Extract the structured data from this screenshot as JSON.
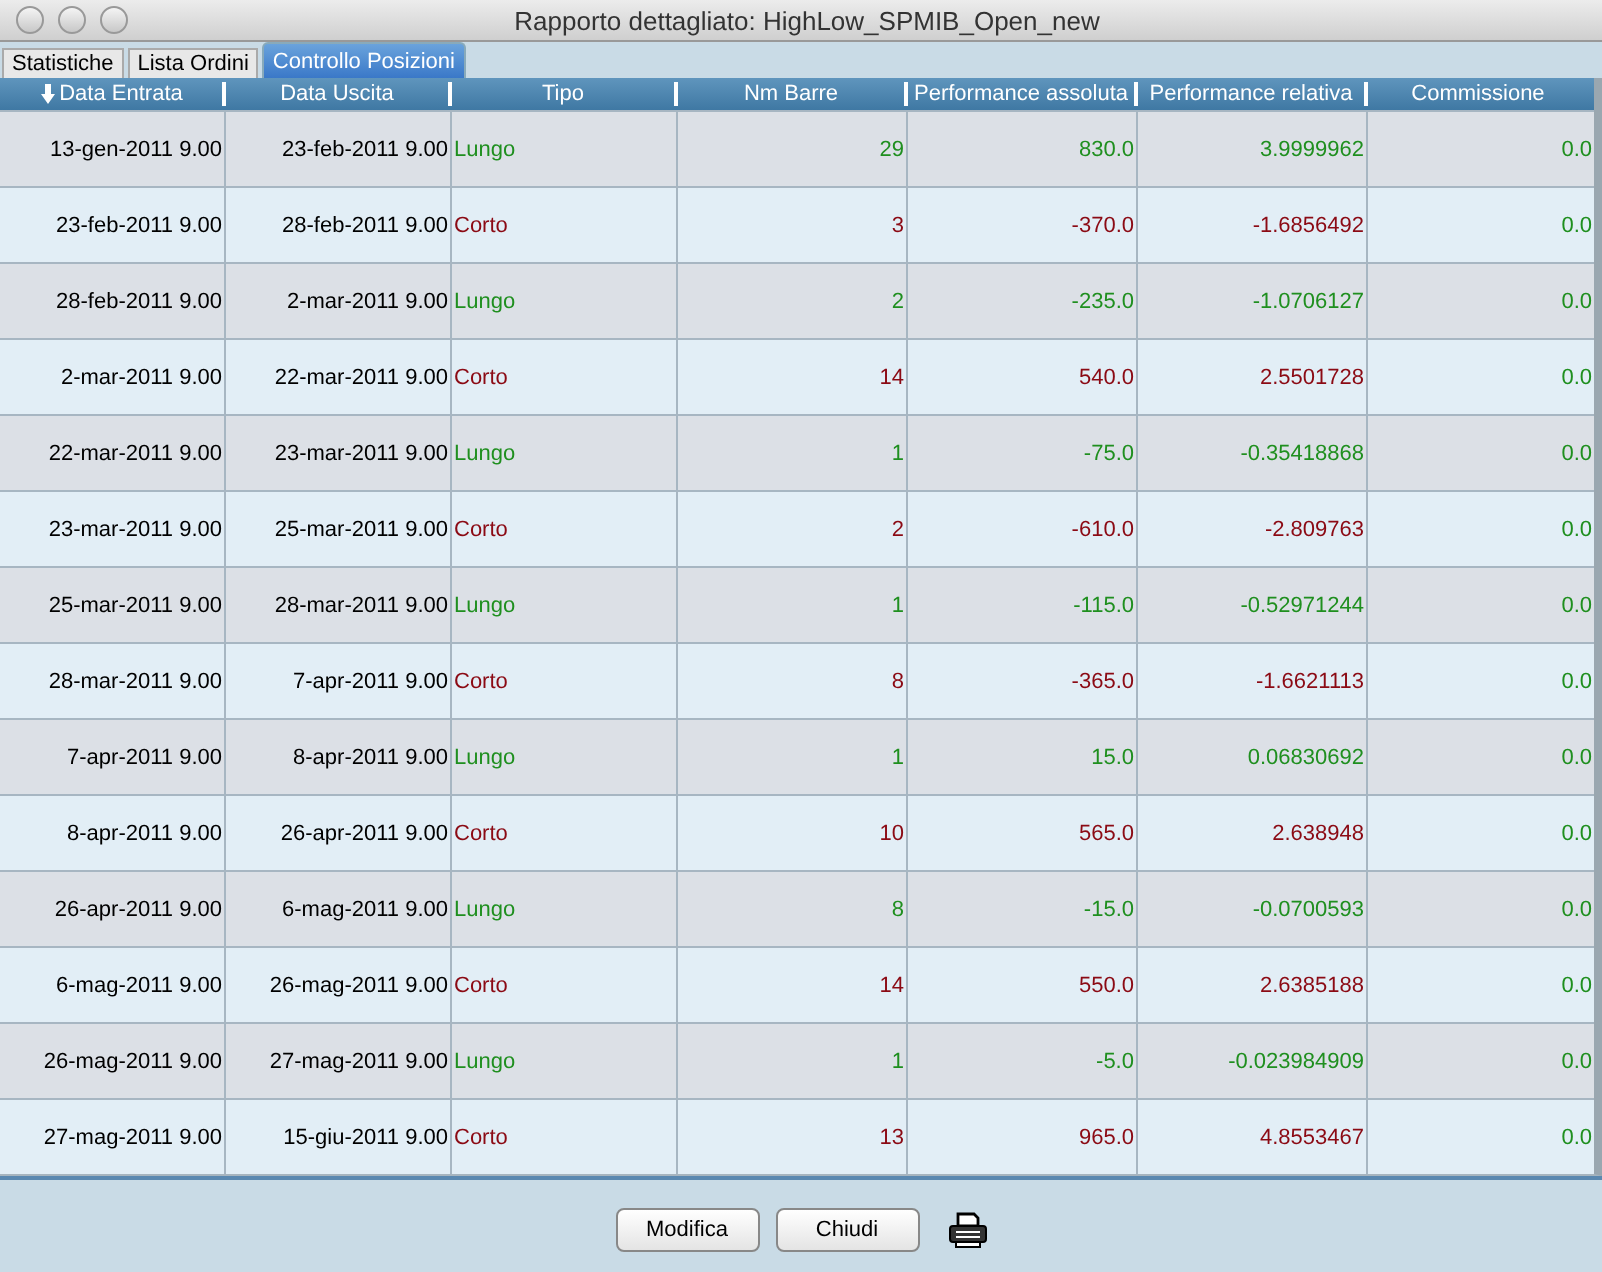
{
  "window": {
    "title": "Rapporto dettagliato: HighLow_SPMIB_Open_new"
  },
  "tabs": [
    {
      "label": "Statistiche",
      "selected": false
    },
    {
      "label": "Lista Ordini",
      "selected": false
    },
    {
      "label": "Controllo Posizioni",
      "selected": true
    }
  ],
  "table": {
    "columns": [
      {
        "label": "Data Entrata",
        "sorted": true
      },
      {
        "label": "Data Uscita",
        "sorted": false
      },
      {
        "label": "Tipo",
        "sorted": false
      },
      {
        "label": "Nm Barre",
        "sorted": false
      },
      {
        "label": "Performance assoluta",
        "sorted": false
      },
      {
        "label": "Performance relativa",
        "sorted": false
      },
      {
        "label": "Commissione",
        "sorted": false
      }
    ],
    "rows": [
      {
        "kind": "long",
        "cells": [
          "13-gen-2011 9.00",
          "23-feb-2011 9.00",
          "Lungo",
          "29",
          "830.0",
          "3.9999962",
          "0.0"
        ]
      },
      {
        "kind": "short",
        "cells": [
          "23-feb-2011 9.00",
          "28-feb-2011 9.00",
          "Corto",
          "3",
          "-370.0",
          "-1.6856492",
          "0.0"
        ]
      },
      {
        "kind": "long",
        "cells": [
          "28-feb-2011 9.00",
          "2-mar-2011 9.00",
          "Lungo",
          "2",
          "-235.0",
          "-1.0706127",
          "0.0"
        ]
      },
      {
        "kind": "short",
        "cells": [
          "2-mar-2011 9.00",
          "22-mar-2011 9.00",
          "Corto",
          "14",
          "540.0",
          "2.5501728",
          "0.0"
        ]
      },
      {
        "kind": "long",
        "cells": [
          "22-mar-2011 9.00",
          "23-mar-2011 9.00",
          "Lungo",
          "1",
          "-75.0",
          "-0.35418868",
          "0.0"
        ]
      },
      {
        "kind": "short",
        "cells": [
          "23-mar-2011 9.00",
          "25-mar-2011 9.00",
          "Corto",
          "2",
          "-610.0",
          "-2.809763",
          "0.0"
        ]
      },
      {
        "kind": "long",
        "cells": [
          "25-mar-2011 9.00",
          "28-mar-2011 9.00",
          "Lungo",
          "1",
          "-115.0",
          "-0.52971244",
          "0.0"
        ]
      },
      {
        "kind": "short",
        "cells": [
          "28-mar-2011 9.00",
          "7-apr-2011 9.00",
          "Corto",
          "8",
          "-365.0",
          "-1.6621113",
          "0.0"
        ]
      },
      {
        "kind": "long",
        "cells": [
          "7-apr-2011 9.00",
          "8-apr-2011 9.00",
          "Lungo",
          "1",
          "15.0",
          "0.06830692",
          "0.0"
        ]
      },
      {
        "kind": "short",
        "cells": [
          "8-apr-2011 9.00",
          "26-apr-2011 9.00",
          "Corto",
          "10",
          "565.0",
          "2.638948",
          "0.0"
        ]
      },
      {
        "kind": "long",
        "cells": [
          "26-apr-2011 9.00",
          "6-mag-2011 9.00",
          "Lungo",
          "8",
          "-15.0",
          "-0.0700593",
          "0.0"
        ]
      },
      {
        "kind": "short",
        "cells": [
          "6-mag-2011 9.00",
          "26-mag-2011 9.00",
          "Corto",
          "14",
          "550.0",
          "2.6385188",
          "0.0"
        ]
      },
      {
        "kind": "long",
        "cells": [
          "26-mag-2011 9.00",
          "27-mag-2011 9.00",
          "Lungo",
          "1",
          "-5.0",
          "-0.023984909",
          "0.0"
        ]
      },
      {
        "kind": "short",
        "cells": [
          "27-mag-2011 9.00",
          "15-giu-2011 9.00",
          "Corto",
          "13",
          "965.0",
          "4.8553467",
          "0.0"
        ]
      }
    ]
  },
  "buttons": [
    "Modifica",
    "Chiudi"
  ]
}
